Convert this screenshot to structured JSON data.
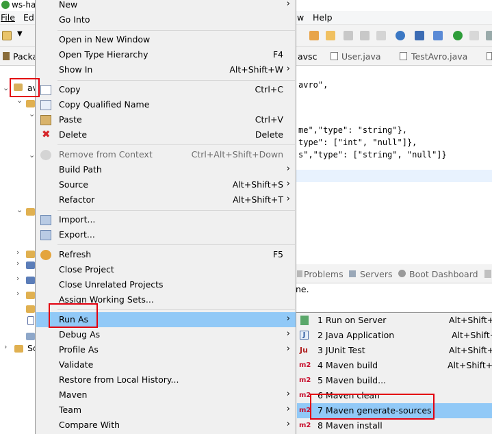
{
  "window": {
    "title": "ws-ha"
  },
  "menubar": {
    "file": "File",
    "edit": "Ed",
    "window": "w",
    "help": "Help"
  },
  "left_tab": {
    "label": "Packa"
  },
  "tree": {
    "project_label": "av",
    "other_label": "Sc"
  },
  "editor_tabs": [
    {
      "label": "avsc"
    },
    {
      "label": "User.java"
    },
    {
      "label": "TestAvro.java"
    }
  ],
  "editor": {
    "lines": [
      "avro\",",
      "",
      "",
      "me\",\"type\": \"string\"},",
      "type\": [\"int\", \"null\"]},",
      "s\",\"type\": [\"string\", \"null\"]}"
    ]
  },
  "bottom_tabs": {
    "problems": "Problems",
    "servers": "Servers",
    "boot": "Boot Dashboard"
  },
  "bottom_text": "ne.",
  "context_menu": {
    "new": {
      "label": "New"
    },
    "go_into": {
      "label": "Go Into"
    },
    "open_new_window": {
      "label": "Open in New Window"
    },
    "open_type_hierarchy": {
      "label": "Open Type Hierarchy",
      "shortcut": "F4"
    },
    "show_in": {
      "label": "Show In",
      "shortcut": "Alt+Shift+W"
    },
    "copy": {
      "label": "Copy",
      "shortcut": "Ctrl+C"
    },
    "copy_qualified": {
      "label": "Copy Qualified Name"
    },
    "paste": {
      "label": "Paste",
      "shortcut": "Ctrl+V"
    },
    "delete": {
      "label": "Delete",
      "shortcut": "Delete"
    },
    "remove_context": {
      "label": "Remove from Context",
      "shortcut": "Ctrl+Alt+Shift+Down"
    },
    "build_path": {
      "label": "Build Path"
    },
    "source": {
      "label": "Source",
      "shortcut": "Alt+Shift+S"
    },
    "refactor": {
      "label": "Refactor",
      "shortcut": "Alt+Shift+T"
    },
    "import": {
      "label": "Import..."
    },
    "export": {
      "label": "Export..."
    },
    "refresh": {
      "label": "Refresh",
      "shortcut": "F5"
    },
    "close_project": {
      "label": "Close Project"
    },
    "close_unrelated": {
      "label": "Close Unrelated Projects"
    },
    "assign_working_sets": {
      "label": "Assign Working Sets..."
    },
    "run_as": {
      "label": "Run As"
    },
    "debug_as": {
      "label": "Debug As"
    },
    "profile_as": {
      "label": "Profile As"
    },
    "validate": {
      "label": "Validate"
    },
    "restore_history": {
      "label": "Restore from Local History..."
    },
    "maven": {
      "label": "Maven"
    },
    "team": {
      "label": "Team"
    },
    "compare_with": {
      "label": "Compare With"
    }
  },
  "run_as_submenu": [
    {
      "icon": "server-run-icon",
      "label": "1 Run on Server",
      "shortcut": "Alt+Shift+X"
    },
    {
      "icon": "java-app-icon",
      "label": "2 Java Application",
      "shortcut": "Alt+Shift+X"
    },
    {
      "icon": "junit-icon",
      "label": "3 JUnit Test",
      "shortcut": "Alt+Shift+X"
    },
    {
      "icon": "maven-icon",
      "label": "4 Maven build",
      "shortcut": "Alt+Shift+X"
    },
    {
      "icon": "maven-icon",
      "label": "5 Maven build...",
      "shortcut": ""
    },
    {
      "icon": "maven-icon",
      "label": "6 Maven clean",
      "shortcut": ""
    },
    {
      "icon": "maven-icon",
      "label": "7 Maven generate-sources",
      "shortcut": ""
    },
    {
      "icon": "maven-icon",
      "label": "8 Maven install",
      "shortcut": ""
    }
  ],
  "icon_text": {
    "maven": "m2",
    "junit": "Ju",
    "java": "J"
  },
  "colors": {
    "highlight": "#91c9f7",
    "annotation_box": "#e3000f",
    "menu_bg": "#f0f0f0"
  }
}
